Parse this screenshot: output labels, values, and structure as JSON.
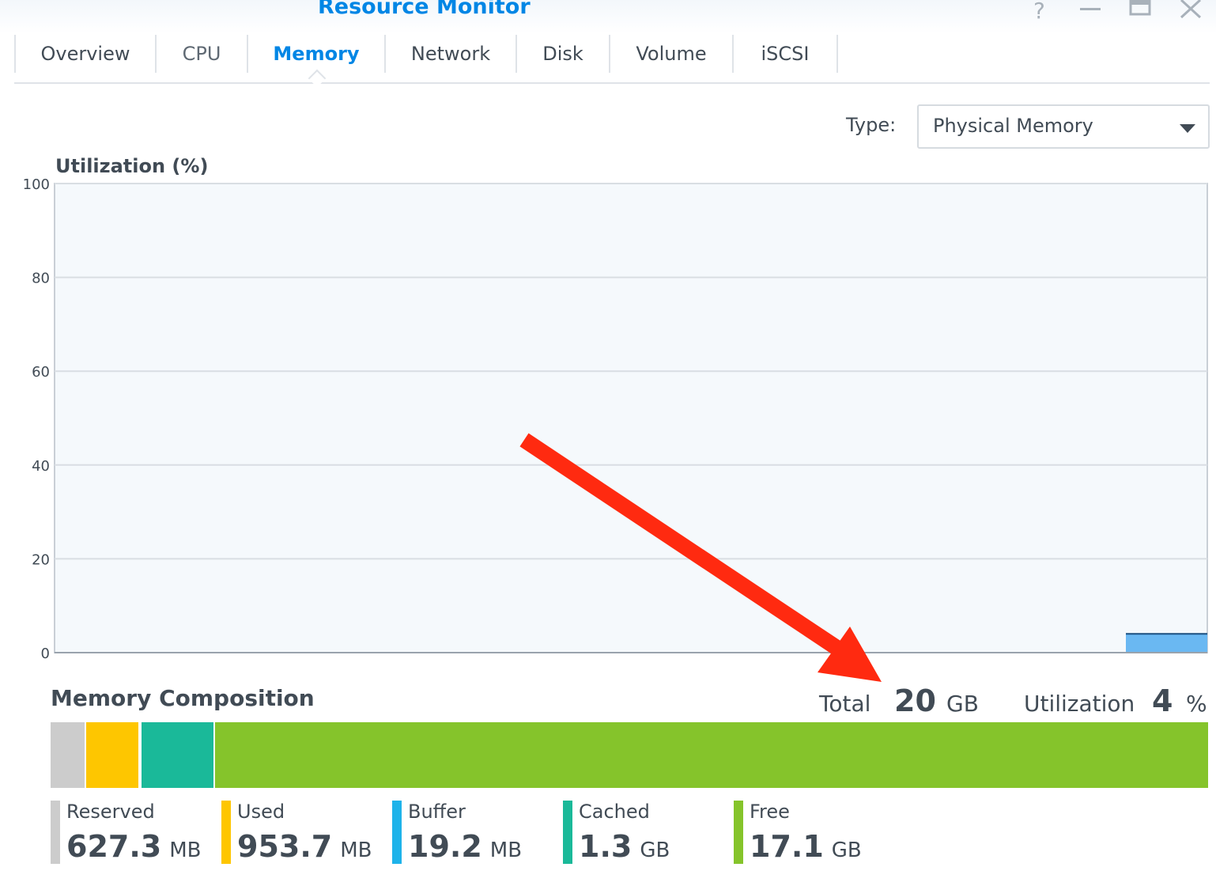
{
  "window": {
    "title": "Resource Monitor",
    "controls": {
      "help_icon": "question-icon",
      "minimize_icon": "minimize-icon",
      "maximize_icon": "maximize-icon",
      "close_icon": "close-icon"
    }
  },
  "tabs": [
    {
      "label": "Overview",
      "active": false
    },
    {
      "label": "CPU",
      "active": false
    },
    {
      "label": "Memory",
      "active": true
    },
    {
      "label": "Network",
      "active": false
    },
    {
      "label": "Disk",
      "active": false
    },
    {
      "label": "Volume",
      "active": false
    },
    {
      "label": "iSCSI",
      "active": false
    }
  ],
  "type_selector": {
    "label": "Type:",
    "value": "Physical Memory",
    "icon": "chevron-down-icon"
  },
  "chart_data": {
    "type": "area",
    "title": "Utilization (%)",
    "xlabel": "",
    "ylabel": "",
    "ylim": [
      0,
      100
    ],
    "yticks": [
      "0",
      "20",
      "40",
      "60",
      "80",
      "100"
    ],
    "grid": true,
    "series": [
      {
        "values": [
          4,
          4
        ]
      }
    ],
    "colors": {
      "fill": "#6ab8f2",
      "line": "#1a4f80",
      "plot_bg": "#f5f9fc",
      "grid": "#d9dee3"
    }
  },
  "composition": {
    "title": "Memory Composition",
    "total_label": "Total",
    "total_value": "20",
    "total_unit": "GB",
    "utilization_label": "Utilization",
    "utilization_value": "4",
    "utilization_unit": "%",
    "items": [
      {
        "name": "Reserved",
        "value": "627.3",
        "unit": "MB",
        "color": "#cccccc"
      },
      {
        "name": "Used",
        "value": "953.7",
        "unit": "MB",
        "color": "#fec600"
      },
      {
        "name": "Buffer",
        "value": "19.2",
        "unit": "MB",
        "color": "#1eb3ea"
      },
      {
        "name": "Cached",
        "value": "1.3",
        "unit": "GB",
        "color": "#1ab999"
      },
      {
        "name": "Free",
        "value": "17.1",
        "unit": "GB",
        "color": "#85c42b"
      }
    ],
    "bar_fractions": [
      0.0306,
      0.0466,
      0.0009,
      0.0635,
      0.8584
    ]
  },
  "annotation": {
    "type": "arrow",
    "color": "#ff2a10"
  }
}
